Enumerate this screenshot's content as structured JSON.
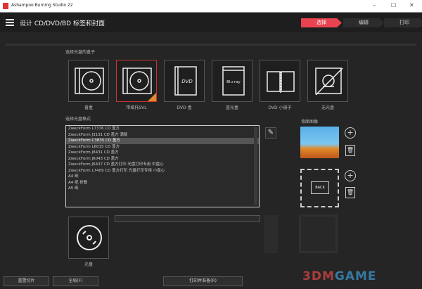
{
  "window": {
    "title": "Ashampoo Burning Studio 22",
    "minimize": "–",
    "maximize": "☐",
    "close": "✕"
  },
  "header": {
    "title": "设计 CD/DVD/BD 标签和封面",
    "steps": [
      "选择",
      "编辑",
      "打印"
    ],
    "accent": "#e8434f"
  },
  "case_section": {
    "label": "选择光盘的盒子",
    "cases": [
      {
        "label": "普盒",
        "icon": "jewel-case-icon"
      },
      {
        "label": "带纸托SVL",
        "icon": "slim-case-icon"
      },
      {
        "label": "DVD 盒",
        "icon": "dvd-case-icon",
        "glyph": "DVD"
      },
      {
        "label": "蓝光盒",
        "icon": "bluray-case-icon",
        "glyph": "Blu-ray"
      },
      {
        "label": "DVD 小册子",
        "icon": "booklet-icon"
      },
      {
        "label": "无光盘",
        "icon": "no-disc-icon"
      }
    ]
  },
  "format_section": {
    "label": "选择光盘格式",
    "items": [
      "ZweckForm L7376 CD 盖方",
      "ZweckForm J3131 CD 盖方 满版",
      "ZweckForm C3835 CD 盖方",
      "ZweckForm L6015 CD 盖方",
      "ZweckForm J8431 CD 盖方",
      "ZweckForm J6043 CD 盖方",
      "ZweckForm J6437 CD 盖方打印 光盘打印专用 中盘心",
      "ZweckForm L7409 CD 盖方打印 光盘打印专用 小盘心",
      "A4 纸",
      "A4 纸 折叠",
      "A5 纸"
    ],
    "selected_index": 2
  },
  "back_section": {
    "label": "背面图像",
    "back_placeholder": "BACK"
  },
  "disc": {
    "label": "光盘"
  },
  "footer": {
    "reset": "重置切片",
    "global": "全局(F)",
    "print": "打印并准备(R)"
  },
  "watermark": {
    "text1": "3DM",
    "text2": "GAME"
  }
}
